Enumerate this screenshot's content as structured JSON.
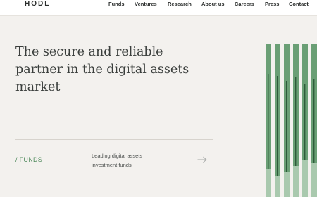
{
  "header": {
    "logo": "HODL",
    "nav": [
      "Funds",
      "Ventures",
      "Research",
      "About us",
      "Careers",
      "Press",
      "Contact"
    ]
  },
  "hero": {
    "title_lines": [
      "The secure and reliable",
      "partner in the digital assets",
      "market"
    ]
  },
  "funds_row": {
    "label": "/ FUNDS",
    "description_lines": [
      "Leading digital assets",
      "investment funds"
    ],
    "arrow_icon": "arrow-right-icon"
  },
  "colors": {
    "accent_green": "#4f8a5c",
    "bar_green": "#6a9f75",
    "bar_dark": "#2e5c3a",
    "bar_light": "#a9c9ae"
  }
}
